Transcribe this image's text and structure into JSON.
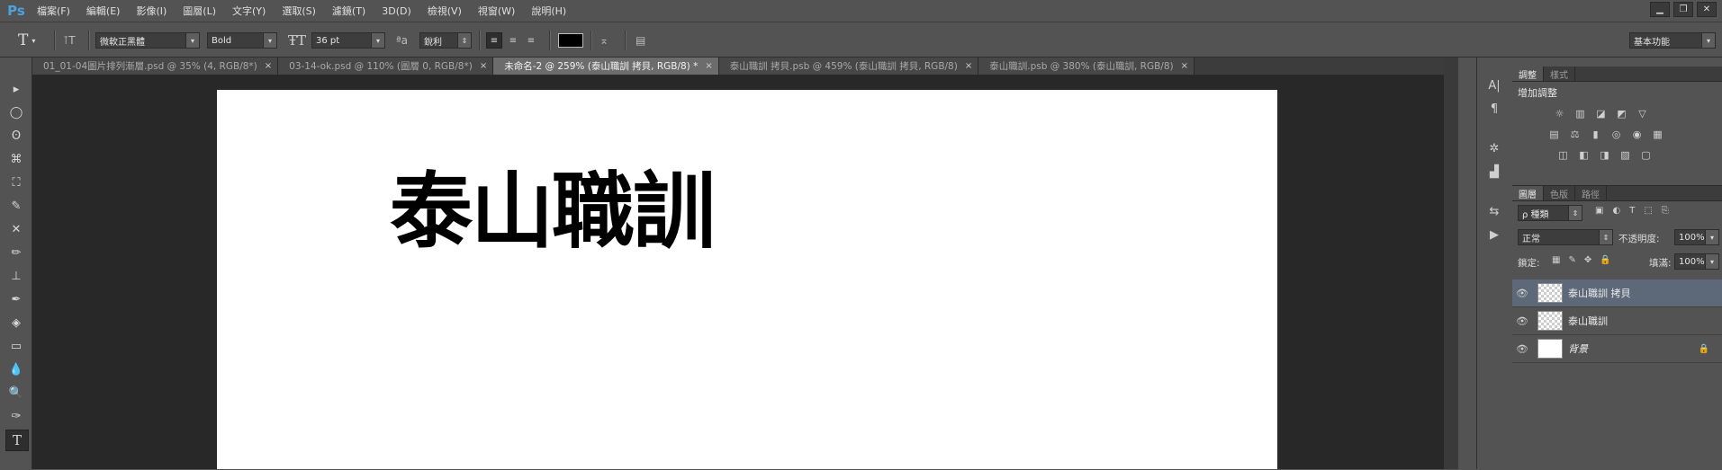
{
  "app": {
    "logo": "Ps"
  },
  "menu": [
    "檔案(F)",
    "編輯(E)",
    "影像(I)",
    "圖層(L)",
    "文字(Y)",
    "選取(S)",
    "濾鏡(T)",
    "3D(D)",
    "檢視(V)",
    "視窗(W)",
    "說明(H)"
  ],
  "window_controls": {
    "minimize": "▁",
    "restore": "❐",
    "close": "✕"
  },
  "options": {
    "tool_glyph": "T",
    "font_family": "微軟正黑體",
    "font_style": "Bold",
    "font_size": "36 pt",
    "aa_glyph": "ªa",
    "anti_alias": "銳利",
    "text_color": "#000000",
    "workspace": "基本功能"
  },
  "tabs": [
    {
      "label": "01_01-04圖片排列漸層.psd @ 35% (4, RGB/8*)",
      "active": false
    },
    {
      "label": "03-14-ok.psd @ 110% (圖層 0, RGB/8*)",
      "active": false
    },
    {
      "label": "未命名-2 @ 259% (泰山職訓 拷貝, RGB/8) *",
      "active": true
    },
    {
      "label": "泰山職訓 拷貝.psb @ 459% (泰山職訓 拷貝, RGB/8)",
      "active": false
    },
    {
      "label": "泰山職訓.psb @ 380% (泰山職訓, RGB/8)",
      "active": false
    }
  ],
  "tab_close": "×",
  "canvas": {
    "text": "泰山職訓"
  },
  "tools": [
    "▸",
    "◯",
    "ʘ",
    "⌘",
    "⛶",
    "✎",
    "✕",
    "✏",
    "⊥",
    "✒",
    "◈",
    "▭",
    "💧",
    "🔍",
    "✑",
    "T"
  ],
  "side_icons": [
    "A|",
    "¶",
    "✲",
    "▟",
    "⇆",
    "▶"
  ],
  "adjust_panel": {
    "tabs": [
      "調整",
      "樣式"
    ],
    "title": "增加調整",
    "row1": [
      "☼",
      "▥",
      "◪",
      "◩",
      "▽"
    ],
    "row2": [
      "▤",
      "⚖",
      "▮",
      "◎",
      "◉",
      "▦"
    ],
    "row3": [
      "◫",
      "◧",
      "◨",
      "▧",
      "▢"
    ]
  },
  "layers_panel": {
    "tabs": [
      "圖層",
      "色版",
      "路徑"
    ],
    "filter_label": "ρ 種類",
    "blend_mode": "正常",
    "opacity_label": "不透明度:",
    "opacity_value": "100%",
    "lock_label": "鎖定:",
    "fill_label": "填滿:",
    "fill_value": "100%",
    "layers": [
      {
        "name": "泰山職訓 拷貝",
        "active": true,
        "thumb": "checker",
        "locked": false
      },
      {
        "name": "泰山職訓",
        "active": false,
        "thumb": "checker",
        "locked": false
      },
      {
        "name": "背景",
        "active": false,
        "thumb": "white",
        "locked": true
      }
    ],
    "lock_icon": "🔒",
    "eye_icon": "👁"
  }
}
